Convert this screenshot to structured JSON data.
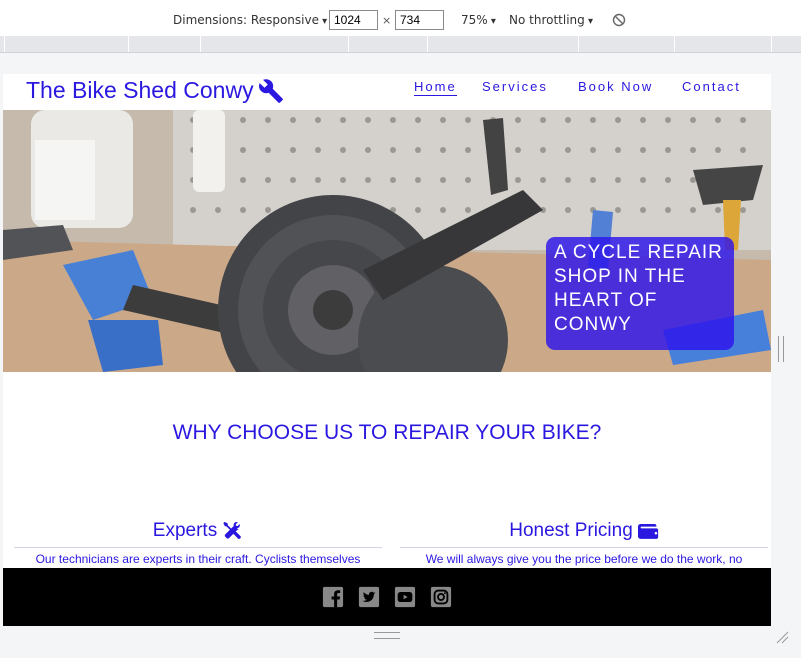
{
  "devtools": {
    "dimensions_label": "Dimensions: Responsive",
    "width_value": "1024",
    "height_value": "734",
    "times_symbol": "×",
    "zoom": "75%",
    "throttling": "No throttling"
  },
  "site": {
    "brand": "The Bike Shed Conwy",
    "nav": [
      "Home",
      "Services",
      "Book Now",
      "Contact"
    ],
    "hero_text": "A cycle repair shop in the heart of Conwy",
    "why_heading": "WHY CHOOSE US TO REPAIR YOUR BIKE?",
    "features": [
      {
        "title": "Experts",
        "text": "Our technicians are experts in their craft. Cyclists themselves",
        "icon": "tools-icon"
      },
      {
        "title": "Honest Pricing",
        "text": "We will always give you the price before we do the work, no",
        "icon": "wallet-icon"
      }
    ],
    "social": [
      "facebook-icon",
      "twitter-icon",
      "youtube-icon",
      "instagram-icon"
    ]
  },
  "colors": {
    "brand_blue": "#2b18e0",
    "footer_bg": "#000000"
  }
}
